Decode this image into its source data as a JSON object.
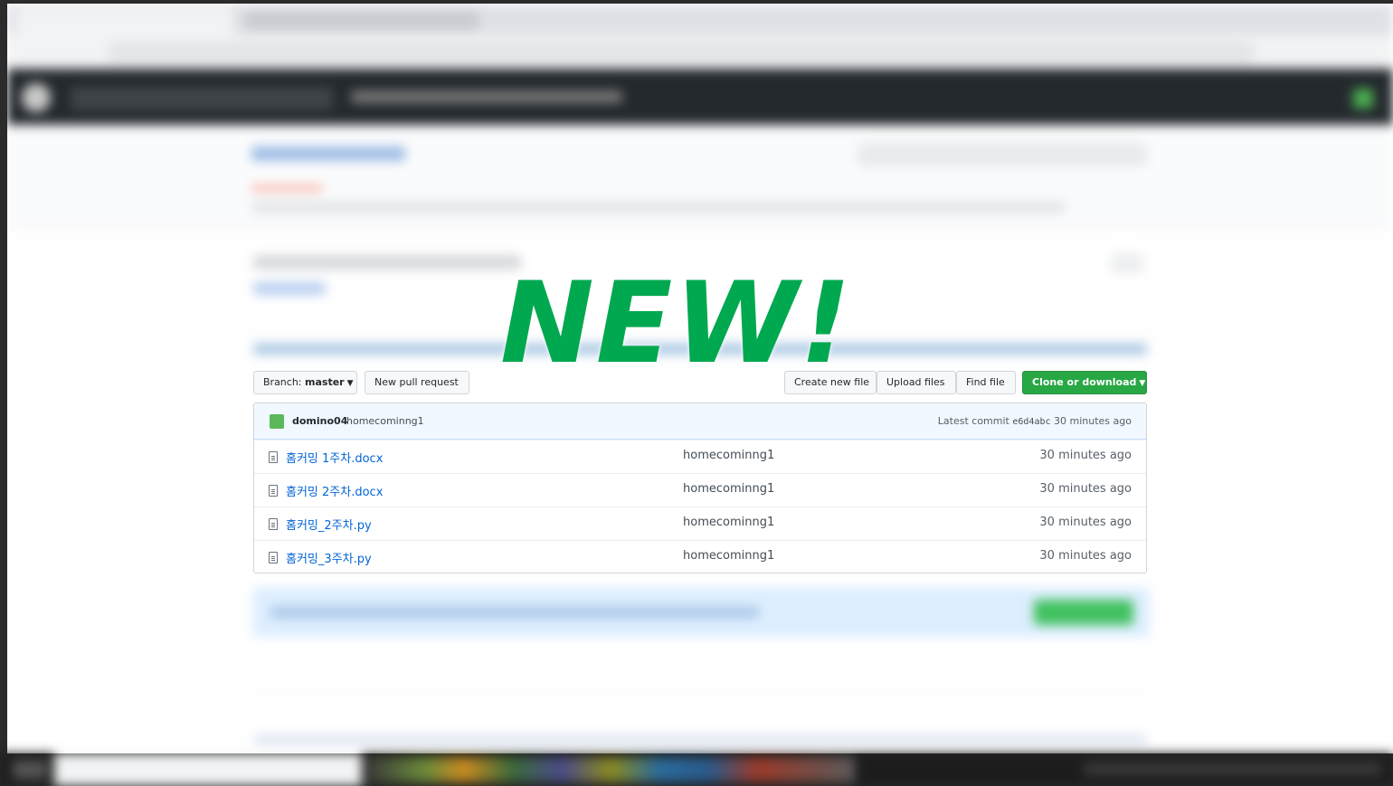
{
  "overlay": {
    "text": "NEW!"
  },
  "file_nav": {
    "branch_label": "Branch:",
    "branch_value": "master",
    "new_pull_request": "New pull request",
    "create_new_file": "Create new file",
    "upload_files": "Upload files",
    "find_file": "Find file",
    "clone_or_download": "Clone or download"
  },
  "commit": {
    "user": "domino04",
    "message": "homecominng1",
    "latest_commit_label": "Latest commit",
    "sha": "e6d4abc",
    "age": "30 minutes ago"
  },
  "files": [
    {
      "name": "홈커밍 1주차.docx",
      "message": "homecominng1",
      "age": "30 minutes ago"
    },
    {
      "name": "홈커밍 2주차.docx",
      "message": "homecominng1",
      "age": "30 minutes ago"
    },
    {
      "name": "홈커밍_2주차.py",
      "message": "homecominng1",
      "age": "30 minutes ago"
    },
    {
      "name": "홈커밍_3주차.py",
      "message": "homecominng1",
      "age": "30 minutes ago"
    }
  ],
  "colors": {
    "overlay": "#00a84f",
    "link": "#0366d6",
    "clone_button": "#28a745",
    "header": "#24292e"
  },
  "icons": [
    "file-icon",
    "caret-down-icon",
    "avatar"
  ]
}
